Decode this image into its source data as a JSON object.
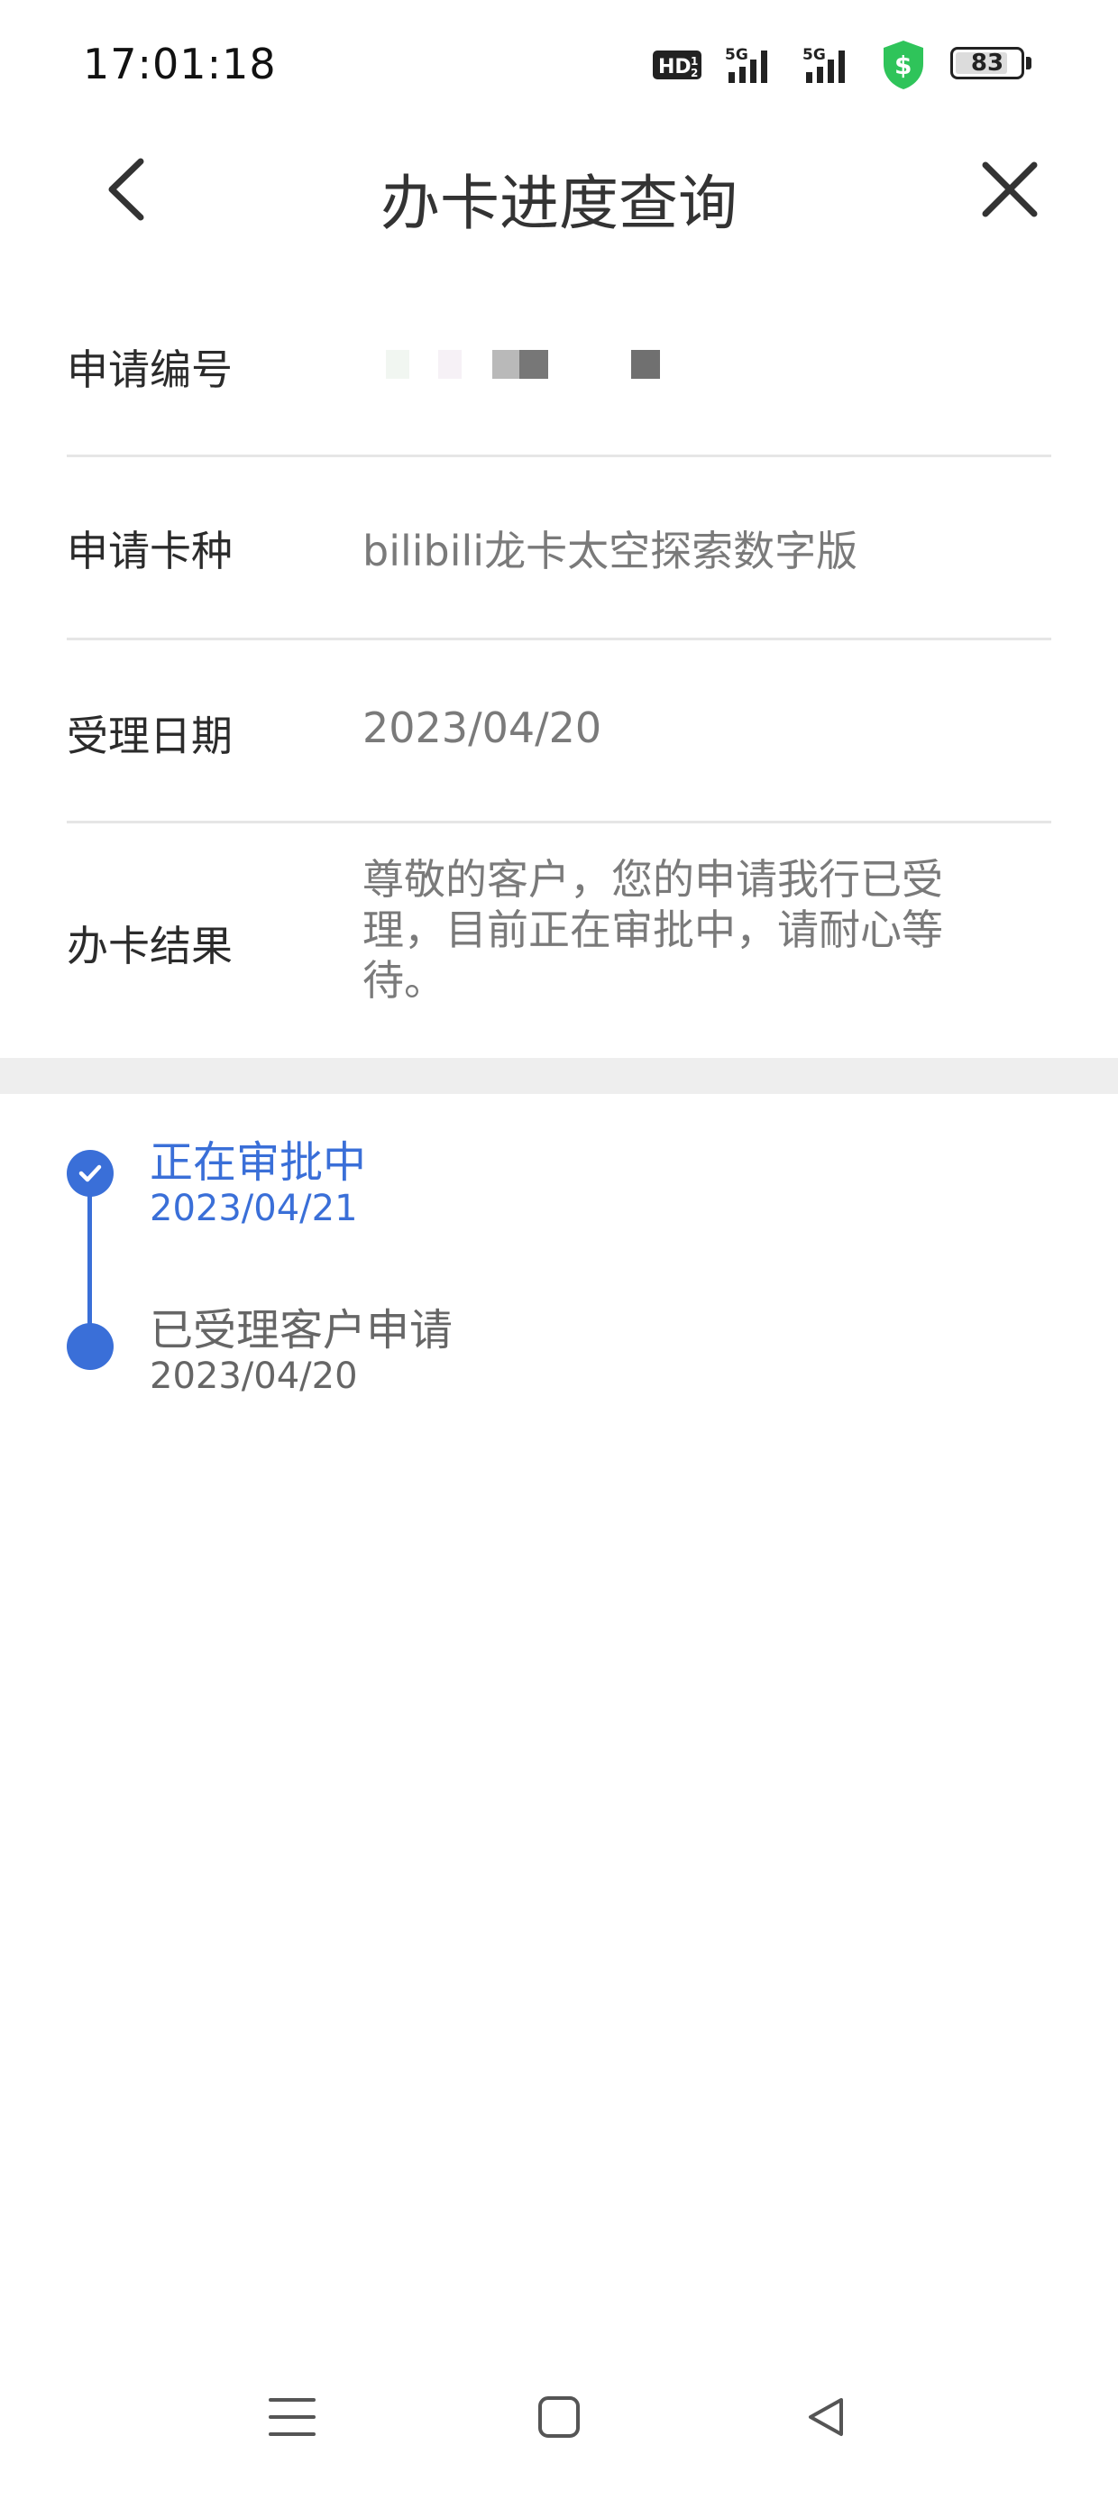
{
  "status_bar": {
    "time": "17:01:18",
    "battery_level": "83",
    "icons": [
      "hd-voice-icon",
      "5g-signal-icon",
      "5g-signal-icon",
      "security-shield-icon",
      "battery-icon"
    ],
    "shield_color": "#2fc45a"
  },
  "nav": {
    "title": "办卡进度查询",
    "back_icon": "chevron-left-icon",
    "close_icon": "close-icon"
  },
  "info": {
    "number_label": "申请编号",
    "card_label": "申请卡种",
    "card_value": "bilibili龙卡太空探索数字版",
    "date_label": "受理日期",
    "date_value": "2023/04/20",
    "result_label": "办卡结果",
    "result_value": "尊敬的客户，您的申请我行已受理，目前正在审批中，请耐心等待。"
  },
  "timeline": {
    "accent_color": "#3a6fd8",
    "steps": [
      {
        "title": "正在审批中",
        "date": "2023/04/21",
        "status": "current"
      },
      {
        "title": "已受理客户申请",
        "date": "2023/04/20",
        "status": "done"
      }
    ]
  },
  "system_nav": {
    "icons": [
      "menu-icon",
      "home-icon",
      "back-triangle-icon"
    ]
  }
}
